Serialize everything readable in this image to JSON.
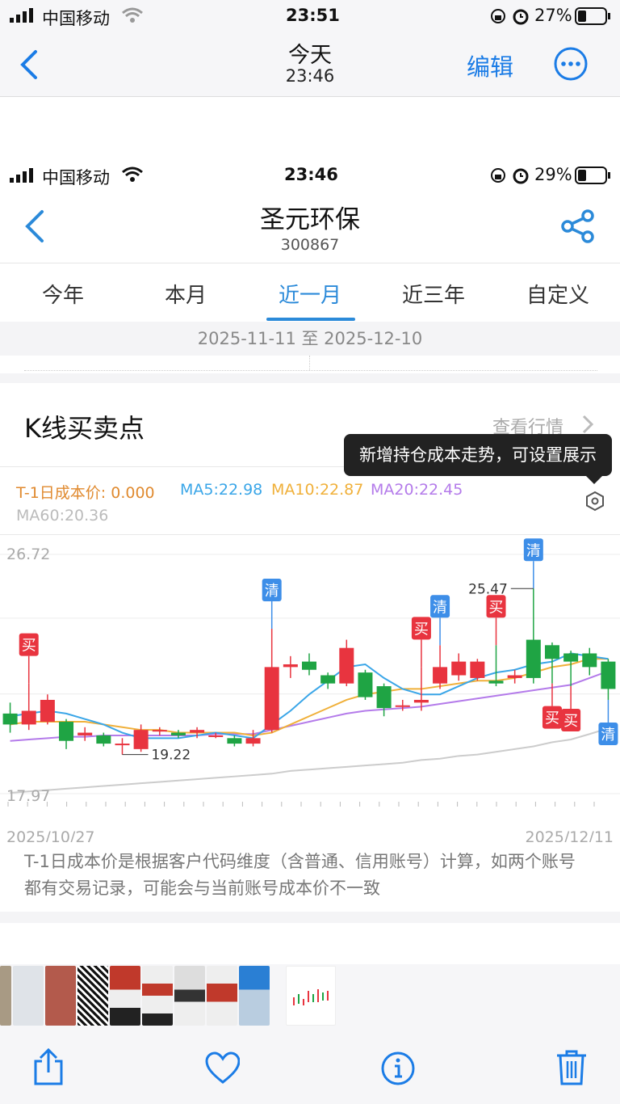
{
  "photos_status": {
    "carrier": "中国移动",
    "time": "23:51",
    "battery": "27%"
  },
  "photos_nav": {
    "title": "今天",
    "subtitle": "23:46",
    "edit_label": "编辑"
  },
  "shot_status": {
    "carrier": "中国移动",
    "time": "23:46",
    "battery": "29%"
  },
  "stock": {
    "name": "圣元环保",
    "code": "300867"
  },
  "tabs": [
    {
      "label": "今年"
    },
    {
      "label": "本月"
    },
    {
      "label": "近一月",
      "active": true
    },
    {
      "label": "近三年"
    },
    {
      "label": "自定义"
    }
  ],
  "date_range": "2025-11-11 至 2025-12-10",
  "card": {
    "title": "K线买卖点",
    "view_label": "查看行情",
    "tooltip": "新增持仓成本走势，可设置展示",
    "cost_label": "T-1日成本价: 0.000",
    "ma5": "MA5:22.98",
    "ma10": "MA10:22.87",
    "ma20": "MA20:22.45",
    "ma60": "MA60:20.36",
    "note": "T-1日成本价是根据客户代码维度（含普通、信用账号）计算，如两个账号都有交易记录，可能会与当前账号成本价不一致"
  },
  "colors": {
    "up": "#e8343f",
    "down": "#1fa444",
    "accent": "#2b8ad9",
    "ma5": "#3aa6e8",
    "ma10": "#f0b03a",
    "ma20": "#b47bea",
    "ma60": "#cccccc"
  },
  "chart_data": {
    "type": "candlestick",
    "ylim": [
      17.97,
      26.72
    ],
    "y_top_label": "26.72",
    "y_bottom_label": "17.97",
    "x_start_label": "2025/10/27",
    "x_end_label": "2025/12/11",
    "max_label": "25.47",
    "min_label": "19.22",
    "candles": [
      {
        "o": 20.9,
        "c": 20.5,
        "h": 21.3,
        "l": 20.2
      },
      {
        "o": 20.5,
        "c": 21.0,
        "h": 22.0,
        "l": 20.3
      },
      {
        "o": 20.6,
        "c": 21.4,
        "h": 21.6,
        "l": 20.5
      },
      {
        "o": 20.6,
        "c": 19.9,
        "h": 20.7,
        "l": 19.6
      },
      {
        "o": 20.1,
        "c": 20.2,
        "h": 20.4,
        "l": 19.9
      },
      {
        "o": 20.1,
        "c": 19.8,
        "h": 20.2,
        "l": 19.7
      },
      {
        "o": 19.8,
        "c": 19.8,
        "h": 20.0,
        "l": 19.4
      },
      {
        "o": 19.6,
        "c": 20.3,
        "h": 20.5,
        "l": 19.5
      },
      {
        "o": 20.3,
        "c": 20.3,
        "h": 20.4,
        "l": 20.1
      },
      {
        "o": 20.2,
        "c": 20.1,
        "h": 20.3,
        "l": 20.0
      },
      {
        "o": 20.2,
        "c": 20.3,
        "h": 20.4,
        "l": 20.0
      },
      {
        "o": 20.1,
        "c": 20.1,
        "h": 20.2,
        "l": 20.0
      },
      {
        "o": 20.0,
        "c": 19.8,
        "h": 20.1,
        "l": 19.7
      },
      {
        "o": 19.8,
        "c": 20.0,
        "h": 20.3,
        "l": 19.7
      },
      {
        "o": 20.3,
        "c": 22.6,
        "h": 24.0,
        "l": 20.2
      },
      {
        "o": 22.6,
        "c": 22.7,
        "h": 23.0,
        "l": 22.2
      },
      {
        "o": 22.8,
        "c": 22.5,
        "h": 23.1,
        "l": 22.3
      },
      {
        "o": 22.3,
        "c": 22.0,
        "h": 22.4,
        "l": 21.8
      },
      {
        "o": 22.0,
        "c": 23.3,
        "h": 23.6,
        "l": 21.9
      },
      {
        "o": 22.4,
        "c": 21.5,
        "h": 22.5,
        "l": 21.4
      },
      {
        "o": 21.9,
        "c": 21.1,
        "h": 22.0,
        "l": 20.8
      },
      {
        "o": 21.2,
        "c": 21.2,
        "h": 21.4,
        "l": 21.0
      },
      {
        "o": 21.3,
        "c": 21.4,
        "h": 22.6,
        "l": 21.0
      },
      {
        "o": 22.0,
        "c": 22.6,
        "h": 23.4,
        "l": 21.8
      },
      {
        "o": 22.3,
        "c": 22.8,
        "h": 23.1,
        "l": 22.1
      },
      {
        "o": 22.2,
        "c": 22.8,
        "h": 22.9,
        "l": 22.1
      },
      {
        "o": 22.1,
        "c": 22.0,
        "h": 23.4,
        "l": 21.9
      },
      {
        "o": 22.2,
        "c": 22.3,
        "h": 22.5,
        "l": 22.0
      },
      {
        "o": 23.6,
        "c": 22.2,
        "h": 25.47,
        "l": 22.0
      },
      {
        "o": 23.4,
        "c": 22.9,
        "h": 23.5,
        "l": 22.0
      },
      {
        "o": 23.1,
        "c": 22.8,
        "h": 23.2,
        "l": 21.9
      },
      {
        "o": 23.1,
        "c": 22.6,
        "h": 23.3,
        "l": 22.3
      },
      {
        "o": 22.8,
        "c": 21.8,
        "h": 22.9,
        "l": 21.4
      }
    ],
    "ma5": [
      20.8,
      20.9,
      21.0,
      20.9,
      20.7,
      20.5,
      20.2,
      20.0,
      20.0,
      20.0,
      20.1,
      20.2,
      20.1,
      20.0,
      20.5,
      21.0,
      21.6,
      22.1,
      22.6,
      22.7,
      22.2,
      21.8,
      21.6,
      21.6,
      21.9,
      22.2,
      22.4,
      22.5,
      22.7,
      22.8,
      23.1,
      23.0,
      22.9
    ],
    "ma10": [
      20.5,
      20.6,
      20.6,
      20.6,
      20.6,
      20.5,
      20.4,
      20.3,
      20.3,
      20.2,
      20.2,
      20.2,
      20.2,
      20.1,
      20.2,
      20.5,
      20.8,
      21.1,
      21.4,
      21.6,
      21.7,
      21.8,
      21.8,
      21.9,
      22.0,
      22.1,
      22.1,
      22.2,
      22.4,
      22.6,
      22.7,
      22.9,
      22.9
    ],
    "ma20": [
      19.9,
      19.95,
      20.0,
      20.05,
      20.05,
      20.1,
      20.1,
      20.1,
      20.1,
      20.1,
      20.1,
      20.15,
      20.15,
      20.15,
      20.3,
      20.45,
      20.6,
      20.75,
      20.9,
      21.0,
      21.05,
      21.1,
      21.15,
      21.25,
      21.35,
      21.45,
      21.55,
      21.65,
      21.75,
      21.85,
      21.95,
      22.2,
      22.45
    ],
    "ma60": [
      18.0,
      18.05,
      18.1,
      18.15,
      18.2,
      18.25,
      18.3,
      18.35,
      18.4,
      18.45,
      18.5,
      18.55,
      18.6,
      18.65,
      18.7,
      18.8,
      18.85,
      18.9,
      18.95,
      19.0,
      19.05,
      19.1,
      19.2,
      19.25,
      19.35,
      19.4,
      19.5,
      19.6,
      19.7,
      19.85,
      19.95,
      20.15,
      20.36
    ],
    "markers": [
      {
        "i": 1,
        "label": "买",
        "kind": "buy",
        "pos": "above"
      },
      {
        "i": 14,
        "label": "清",
        "kind": "clear",
        "pos": "above"
      },
      {
        "i": 22,
        "label": "买",
        "kind": "buy",
        "pos": "above"
      },
      {
        "i": 23,
        "label": "清",
        "kind": "clear",
        "pos": "above"
      },
      {
        "i": 26,
        "label": "买",
        "kind": "buy",
        "pos": "above"
      },
      {
        "i": 28,
        "label": "清",
        "kind": "clear",
        "pos": "above"
      },
      {
        "i": 29,
        "label": "买",
        "kind": "buy",
        "pos": "below"
      },
      {
        "i": 30,
        "label": "买",
        "kind": "buy",
        "pos": "below"
      },
      {
        "i": 32,
        "label": "清",
        "kind": "clear",
        "pos": "below"
      }
    ]
  }
}
